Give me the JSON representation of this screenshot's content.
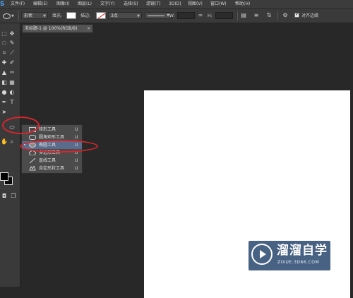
{
  "menubar": {
    "logo": "S",
    "items": [
      "文件(F)",
      "编辑(E)",
      "图像(I)",
      "图层(L)",
      "文字(Y)",
      "选择(S)",
      "滤镜(T)",
      "3D(D)",
      "视图(V)",
      "窗口(W)",
      "帮助(H)"
    ]
  },
  "options": {
    "mode_select": "形状",
    "fill_label": "填充:",
    "stroke_label": "描边:",
    "stroke_width": "3点",
    "w_label": "W:",
    "h_label": "H:",
    "align_edges_label": "对齐边缘"
  },
  "document": {
    "tab_title": "未标题-1 @ 100%(RGB/8)",
    "close": "×"
  },
  "flyout": {
    "items": [
      {
        "label": "矩形工具",
        "key": "U",
        "icon": "rectangle-icon",
        "active": false
      },
      {
        "label": "圆角矩形工具",
        "key": "U",
        "icon": "rounded-rectangle-icon",
        "active": false
      },
      {
        "label": "椭圆工具",
        "key": "U",
        "icon": "ellipse-icon",
        "active": true
      },
      {
        "label": "多边形工具",
        "key": "U",
        "icon": "polygon-icon",
        "active": false
      },
      {
        "label": "直线工具",
        "key": "U",
        "icon": "line-icon",
        "active": false
      },
      {
        "label": "自定形状工具",
        "key": "U",
        "icon": "custom-shape-icon",
        "active": false
      }
    ],
    "active_marker": "•"
  },
  "watermark": {
    "title": "溜溜自学",
    "url": "ZIXUE.3D66.COM"
  },
  "colors": {
    "annotation": "#d6262b",
    "selected_item": "#5b6b8b",
    "foreground": "#000000",
    "background": "#0a0a0a"
  }
}
